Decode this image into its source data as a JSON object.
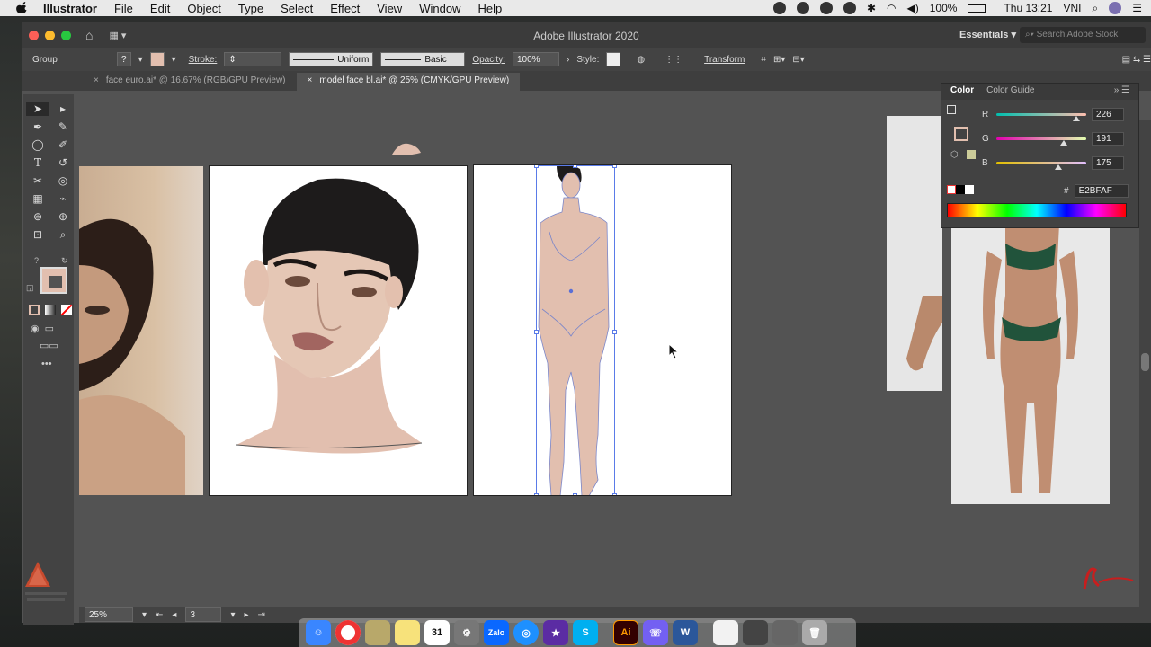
{
  "menubar": {
    "app": "Illustrator",
    "items": [
      "File",
      "Edit",
      "Object",
      "Type",
      "Select",
      "Effect",
      "View",
      "Window",
      "Help"
    ],
    "battery": "100%",
    "clock": "Thu 13:21",
    "input_method": "VNI"
  },
  "window": {
    "title": "Adobe Illustrator 2020",
    "workspace": "Essentials",
    "stock_placeholder": "Search Adobe Stock"
  },
  "control_bar": {
    "selection": "Group",
    "stroke_label": "Stroke:",
    "profile_uniform": "Uniform",
    "brush_basic": "Basic",
    "opacity_label": "Opacity:",
    "opacity_value": "100%",
    "style_label": "Style:",
    "transform": "Transform"
  },
  "tabs": [
    {
      "label": "face euro.ai* @ 16.67% (RGB/GPU Preview)"
    },
    {
      "label": "model face bl.ai* @ 25% (CMYK/GPU Preview)"
    }
  ],
  "color_panel": {
    "tab_color": "Color",
    "tab_guide": "Color Guide",
    "r_label": "R",
    "r_value": "226",
    "r_fraction": 0.886,
    "g_label": "G",
    "g_value": "191",
    "g_fraction": 0.749,
    "b_label": "B",
    "b_value": "175",
    "b_fraction": 0.686,
    "hex_label": "#",
    "hex_value": "E2BFAF",
    "fill_color": "#E2BFAF"
  },
  "status_bar": {
    "zoom": "25%",
    "artboard": "3"
  },
  "dock": {
    "calendar_day": "31",
    "zalo": "Zalo",
    "illustrator": "Ai"
  }
}
